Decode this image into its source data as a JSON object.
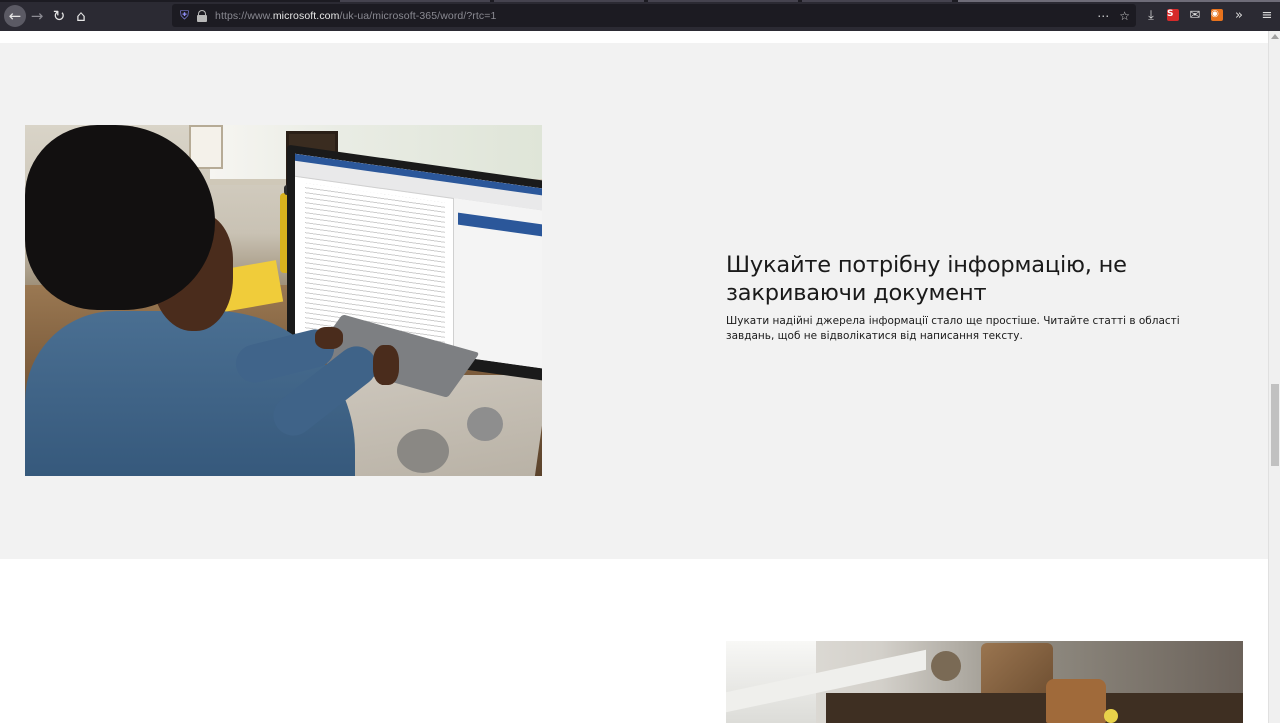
{
  "browser": {
    "url_prefix": "https://www.",
    "url_domain": "microsoft.com",
    "url_path": "/uk-ua/microsoft-365/word/?rtc=1",
    "icons": {
      "back": "back-arrow-icon",
      "forward": "forward-arrow-icon",
      "reload": "reload-icon",
      "home": "home-icon",
      "tracking": "shield-icon",
      "lock": "lock-icon",
      "page_actions": "more-horizontal-icon",
      "bookmark": "star-icon",
      "downloads": "download-icon",
      "extension_red": "extension-red-icon",
      "mail": "mail-icon",
      "extension_orange": "extension-orange-icon",
      "overflow": "chevron-double-right-icon",
      "menu": "hamburger-menu-icon"
    }
  },
  "feature": {
    "title": "Шукайте потрібну інформацію, не закриваючи документ",
    "description": "Шукати надійні джерела інформації стало ще простіше. Читайте статті в області завдань, щоб не відволікатися від написання тексту."
  },
  "colors": {
    "section_background": "#f2f2f2",
    "text": "#1a1a1a",
    "chrome_background": "#2b2a33",
    "url_background": "#1c1b22"
  }
}
